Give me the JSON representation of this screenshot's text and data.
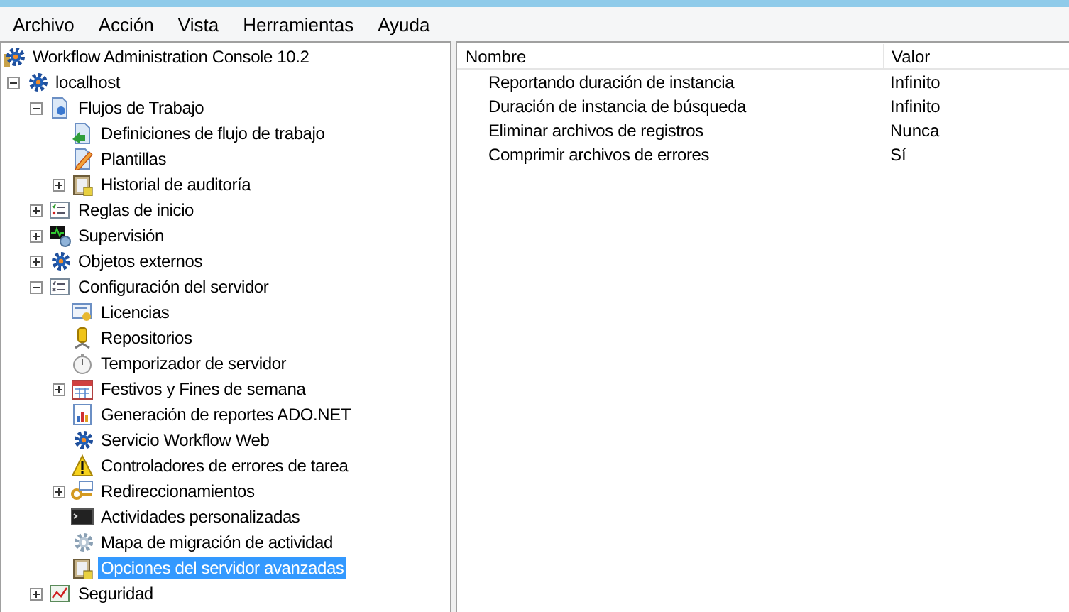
{
  "menu": [
    "Archivo",
    "Acción",
    "Vista",
    "Herramientas",
    "Ayuda"
  ],
  "tree": [
    {
      "label": "Workflow Administration Console 10.2",
      "kind": "console",
      "selected": false,
      "children": [
        {
          "label": "localhost",
          "kind": "gear",
          "selected": false,
          "expanded": true,
          "children": [
            {
              "label": "Flujos de Trabajo",
              "kind": "document",
              "selected": false,
              "expanded": true,
              "children": [
                {
                  "label": "Definiciones de flujo de trabajo",
                  "kind": "doc-arrow",
                  "selected": false
                },
                {
                  "label": "Plantillas",
                  "kind": "pencil",
                  "selected": false
                },
                {
                  "label": "Historial de auditoría",
                  "kind": "clipboard",
                  "selected": false,
                  "expanded": false
                }
              ]
            },
            {
              "label": "Reglas de inicio",
              "kind": "checklist",
              "selected": false,
              "expanded": false
            },
            {
              "label": "Supervisión",
              "kind": "monitor",
              "selected": false,
              "expanded": false
            },
            {
              "label": "Objetos externos",
              "kind": "gear",
              "selected": false,
              "expanded": false
            },
            {
              "label": "Configuración del servidor",
              "kind": "list",
              "selected": false,
              "expanded": true,
              "children": [
                {
                  "label": "Licencias",
                  "kind": "certificate",
                  "selected": false
                },
                {
                  "label": "Repositorios",
                  "kind": "database",
                  "selected": false
                },
                {
                  "label": "Temporizador de servidor",
                  "kind": "stopwatch",
                  "selected": false
                },
                {
                  "label": "Festivos y Fines de semana",
                  "kind": "calendar",
                  "selected": false,
                  "expanded": false
                },
                {
                  "label": "Generación de reportes ADO.NET",
                  "kind": "report",
                  "selected": false
                },
                {
                  "label": "Servicio Workflow Web",
                  "kind": "gear",
                  "selected": false
                },
                {
                  "label": "Controladores de errores de tarea",
                  "kind": "warning",
                  "selected": false
                },
                {
                  "label": "Redireccionamientos",
                  "kind": "key",
                  "selected": false,
                  "expanded": false
                },
                {
                  "label": "Actividades personalizadas",
                  "kind": "terminal",
                  "selected": false
                },
                {
                  "label": "Mapa de migración de actividad",
                  "kind": "cog-grey",
                  "selected": false
                },
                {
                  "label": "Opciones del servidor avanzadas",
                  "kind": "clipboard",
                  "selected": true
                }
              ]
            },
            {
              "label": "Seguridad",
              "kind": "security",
              "selected": false,
              "expanded": false
            }
          ]
        }
      ]
    }
  ],
  "table": {
    "columns": [
      "Nombre",
      "Valor"
    ],
    "rows": [
      {
        "name": "Reportando duración de instancia",
        "value": "Infinito"
      },
      {
        "name": "Duración de instancia de búsqueda",
        "value": "Infinito"
      },
      {
        "name": "Eliminar archivos de registros",
        "value": "Nunca"
      },
      {
        "name": "Comprimir archivos de errores",
        "value": "Sí"
      }
    ]
  }
}
